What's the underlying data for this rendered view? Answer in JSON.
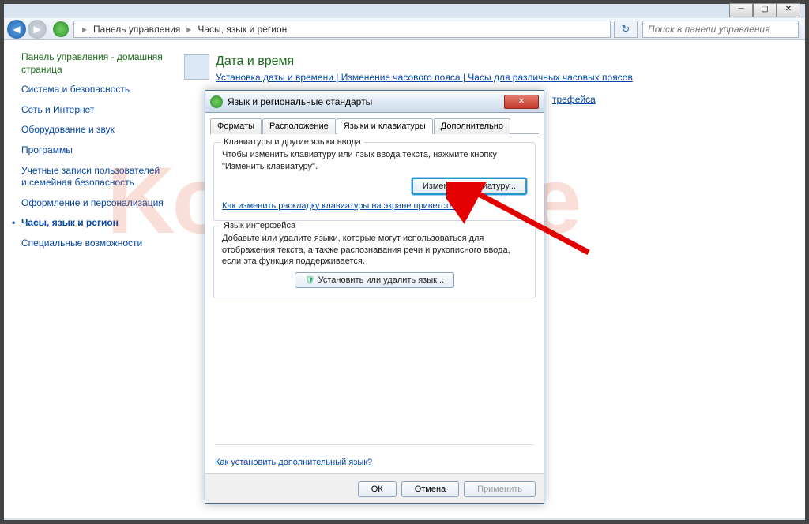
{
  "titlebar": {
    "min": "─",
    "max": "▢",
    "close": "✕"
  },
  "nav": {
    "back_glyph": "◀",
    "fwd_glyph": "▶",
    "breadcrumb": {
      "root": "Панель управления",
      "sep": "▸",
      "current": "Часы, язык и регион"
    },
    "refresh_glyph": "↻",
    "search_placeholder": "Поиск в панели управления"
  },
  "sidebar": {
    "home": "Панель управления - домашняя страница",
    "items": [
      "Система и безопасность",
      "Сеть и Интернет",
      "Оборудование и звук",
      "Программы",
      "Учетные записи пользователей и семейная безопасность",
      "Оформление и персонализация",
      "Часы, язык и регион",
      "Специальные возможности"
    ],
    "current_index": 6
  },
  "content": {
    "sections": [
      {
        "title": "Дата и время",
        "links": "Установка даты и времени | Изменение часового пояса | Часы для различных часовых поясов"
      },
      {
        "behind_link": "трефейса"
      }
    ]
  },
  "dialog": {
    "title": "Язык и региональные стандарты",
    "close_glyph": "✕",
    "tabs": [
      "Форматы",
      "Расположение",
      "Языки и клавиатуры",
      "Дополнительно"
    ],
    "active_tab": 2,
    "group1": {
      "title": "Клавиатуры и другие языки ввода",
      "text": "Чтобы изменить клавиатуру или язык ввода текста, нажмите кнопку \"Изменить клавиатуру\".",
      "button": "Изменить клавиатуру...",
      "link": "Как изменить раскладку клавиатуры на экране приветствия"
    },
    "group2": {
      "title": "Язык интерфейса",
      "text": "Добавьте или удалите языки, которые могут использоваться для отображения текста, а также распознавания речи и рукописного ввода, если эта функция поддерживается.",
      "button": "Установить или удалить язык..."
    },
    "bottom_link": "Как установить дополнительный язык?",
    "footer": {
      "ok": "ОК",
      "cancel": "Отмена",
      "apply": "Применить"
    }
  },
  "watermark": "KompoSite"
}
